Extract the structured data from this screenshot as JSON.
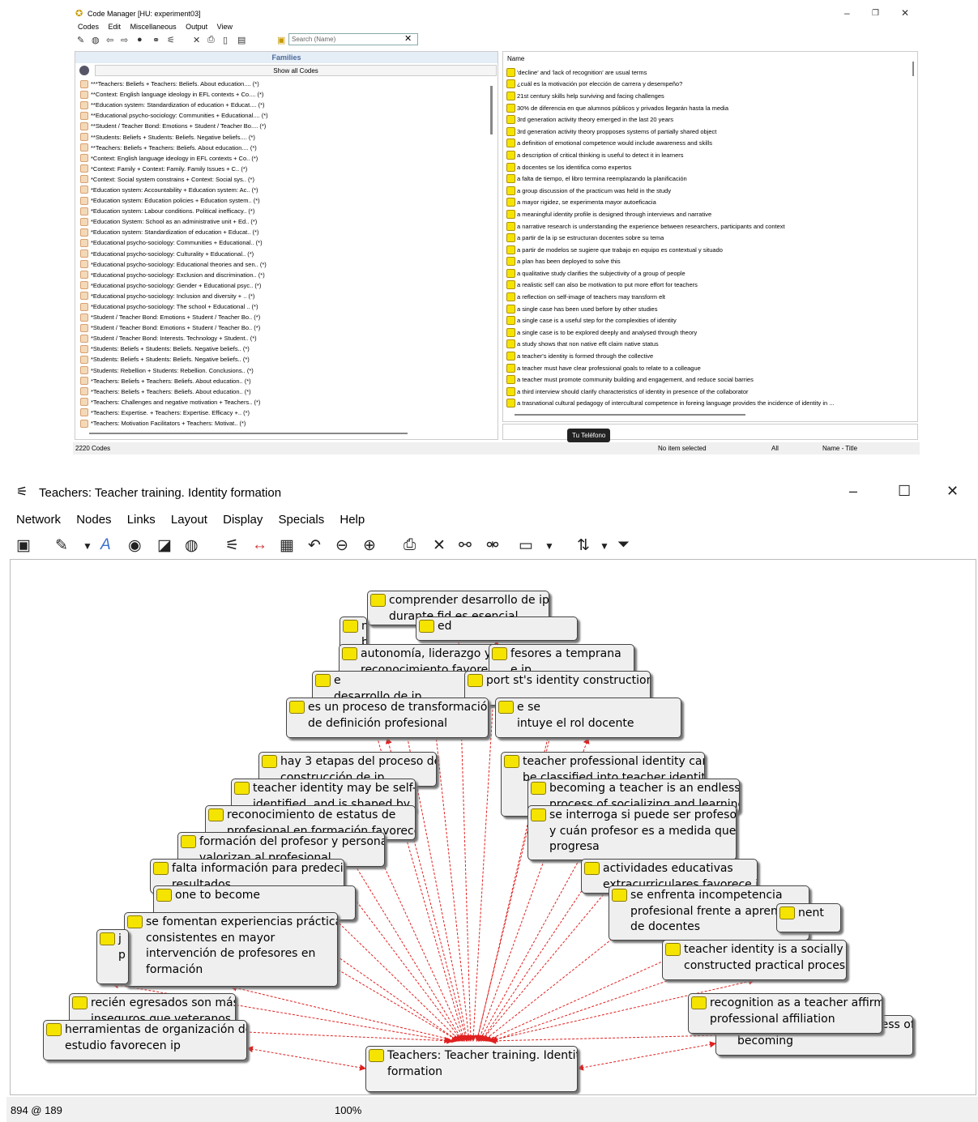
{
  "code_manager": {
    "title": "Code Manager [HU: experiment03]",
    "menu": [
      "Codes",
      "Edit",
      "Miscellaneous",
      "Output",
      "View"
    ],
    "search_placeholder": "Search (Name)",
    "families_header": "Families",
    "show_all": "Show all Codes",
    "families": [
      "***Teachers: Beliefs + Teachers: Beliefs. About education.... (*)",
      "**Context: English language ideology in EFL contexts + Co.... (*)",
      "**Education system: Standardization of education + Educat.... (*)",
      "**Educational psycho-sociology: Communities + Educational.... (*)",
      "**Student / Teacher Bond: Emotions + Student / Teacher Bo.... (*)",
      "**Students: Beliefs + Students: Beliefs. Negative beliefs.... (*)",
      "**Teachers: Beliefs + Teachers: Beliefs. About education.... (*)",
      "*Context: English language ideology in EFL contexts + Co.. (*)",
      "*Context: Family + Context: Family. Family Issues + C.. (*)",
      "*Context: Social system constrains + Context: Social sys.. (*)",
      "*Education system: Accountability + Education system: Ac.. (*)",
      "*Education system: Education policies + Education system.. (*)",
      "*Education system: Labour conditions. Political inefficacy.. (*)",
      "*Education System: School as an administrative unit + Ed.. (*)",
      "*Education system: Standardization of education + Educat.. (*)",
      "*Educational psycho-sociology: Communities + Educational.. (*)",
      "*Educational psycho-sociology: Culturality + Educational.. (*)",
      "*Educational psycho-sociology: Educational theories and sen.. (*)",
      "*Educational psycho-sociology: Exclusion and discrimination.. (*)",
      "*Educational psycho-sociology: Gender + Educational psyc.. (*)",
      "*Educational psycho-sociology: Inclusion and diversity + .. (*)",
      "*Educational psycho-sociology: The school + Educational .. (*)",
      "*Student / Teacher Bond: Emotions + Student / Teacher Bo.. (*)",
      "*Student / Teacher Bond: Emotions + Student / Teacher Bo.. (*)",
      "*Student / Teacher Bond: Interests. Technology + Student.. (*)",
      "*Students: Beliefs + Students: Beliefs. Negative beliefs.. (*)",
      "*Students: Beliefs + Students: Beliefs. Negative beliefs.. (*)",
      "*Students: Rebellion + Students: Rebellion. Conclusions.. (*)",
      "*Teachers: Beliefs + Teachers: Beliefs. About education.. (*)",
      "*Teachers: Beliefs + Teachers: Beliefs. About education.. (*)",
      "*Teachers: Challenges and negative motivation + Teachers.. (*)",
      "*Teachers: Expertise. + Teachers: Expertise. Efficacy +.. (*)",
      "*Teachers: Motivation Facilitators + Teachers: Motivat.. (*)"
    ],
    "name_header": "Name",
    "codes": [
      "'decline' and 'lack of recognition' are usual terms",
      "¿cuál es la motivación por elección de carrera y desempeño?",
      "21st century skills help surviving and facing challenges",
      "30% de diferencia en que alumnos públicos y privados llegarán hasta la media",
      "3rd generation activity theory emerged in the last 20 years",
      "3rd generation activity theory propposes systems of partially shared object",
      "a definition of emotional competence would include awareness and skills",
      "a description of critical thinking is useful to detect it in learners",
      "a docentes se los identifica como expertos",
      "a falta de tiempo, el libro termina reemplazando la planificación",
      "a group discussion of the practicum was held in the study",
      "a mayor rigidez, se experimenta mayor autoeficacia",
      "a meaningful identity profile is designed through interviews and narrative",
      "a narrative research is understanding the experience between researchers, participants and context",
      "a partir de la ip se estructuran docentes sobre su tema",
      "a partir de modelos se sugiere que trabajo en equipo es contextual y situado",
      "a plan has been deployed to solve this",
      "a qualitative study clarifies the subjectivity of a group of people",
      "a realistic self can also be motivation to put more effort for teachers",
      "a reflection on self-image of teachers may transform elt",
      "a single case has been used before by other studies",
      "a single case is a useful step for the complexities of identity",
      "a single case is to be explored deeply and analysed through theory",
      "a study shows that non native eflt claim native status",
      "a teacher's identity is formed through the collective",
      "a teacher must have clear professional goals to relate to a colleague",
      "a teacher must promote community building and engagement, and reduce social barries",
      "a third interview should clarify characteristics of identity in presence of the collaborator",
      "a trasnational cultural pedagogy of intercultural competence in foreing language provides the incidence of identity in ..."
    ],
    "tooltip": "Tu Teléfono",
    "status": {
      "count": "2220 Codes",
      "selection": "No item selected",
      "filter": "All",
      "sort": "Name - Title"
    }
  },
  "network": {
    "title": "Teachers: Teacher training. Identity formation",
    "menu": [
      "Network",
      "Nodes",
      "Links",
      "Layout",
      "Display",
      "Specials",
      "Help"
    ],
    "center": {
      "line1": "Teachers: Teacher training. Identity",
      "line2": "formation"
    },
    "nodes": [
      {
        "line1": "comprender desarrollo de ip",
        "line2": "durante fid es esencial"
      },
      {
        "line1": "m",
        "line2": "bien"
      },
      {
        "line1": "ed",
        "line2": ""
      },
      {
        "line1": "autonomía, liderazgo y",
        "line2": "reconocimiento favorecen ip"
      },
      {
        "line1": "fesores a temprana",
        "line2": "e ip"
      },
      {
        "line1": "e",
        "line2": "desarrollo de ip"
      },
      {
        "line1": "port st's identity construction",
        "line2": ""
      },
      {
        "line1": "es un proceso de transformación",
        "line2": "de definición profesional"
      },
      {
        "line1": "e se",
        "line2": "intuye el rol docente"
      },
      {
        "line1": "hay 3 etapas del proceso de",
        "line2": "construcción de ip"
      },
      {
        "line1": "teacher identity may be self-",
        "line2": "identified, and is shaped by"
      },
      {
        "line1": "reconocimiento de estatus de",
        "line2": "profesional en formación favorece"
      },
      {
        "line1": "formación del profesor y persona",
        "line2": "valorizan al profesional"
      },
      {
        "line1": "falta información para predecir",
        "line2": "resultados"
      },
      {
        "line1": "",
        "line2": "one to become"
      },
      {
        "line1": "se fomentan experiencias prácticas",
        "line2": "consistentes en mayor",
        "line3": "intervención de profesores en",
        "line4": "formación"
      },
      {
        "line1": "j",
        "line2": "p"
      },
      {
        "line1": "recién egresados son más",
        "line2": "inseguros que veteranos"
      },
      {
        "line1": "herramientas de organización de",
        "line2": "estudio favorecen ip"
      },
      {
        "line1": "teacher professional identity can",
        "line2": "be classified into teacher identity"
      },
      {
        "line1": "becoming a teacher is an endless",
        "line2": "process of socializing and learning"
      },
      {
        "line1": "se interroga si puede ser profesor",
        "line2": "y cuán profesor es a medida que",
        "line3": "progresa"
      },
      {
        "line1": "actividades educativas",
        "line2": "extracurriculares favorece ip"
      },
      {
        "line1": "se enfrenta incompetencia",
        "line2": "profesional frente a aprendizajes",
        "line3": "de docentes"
      },
      {
        "line1": "nent",
        "line2": ""
      },
      {
        "line1": "teacher identity is a socially",
        "line2": "constructed practical process"
      },
      {
        "line1": "identity is a singular process of",
        "line2": "becoming"
      },
      {
        "line1": "recognition as a teacher affirms",
        "line2": "professional affiliation"
      }
    ],
    "status": {
      "coords": "894 @ 189",
      "zoom": "100%"
    }
  }
}
